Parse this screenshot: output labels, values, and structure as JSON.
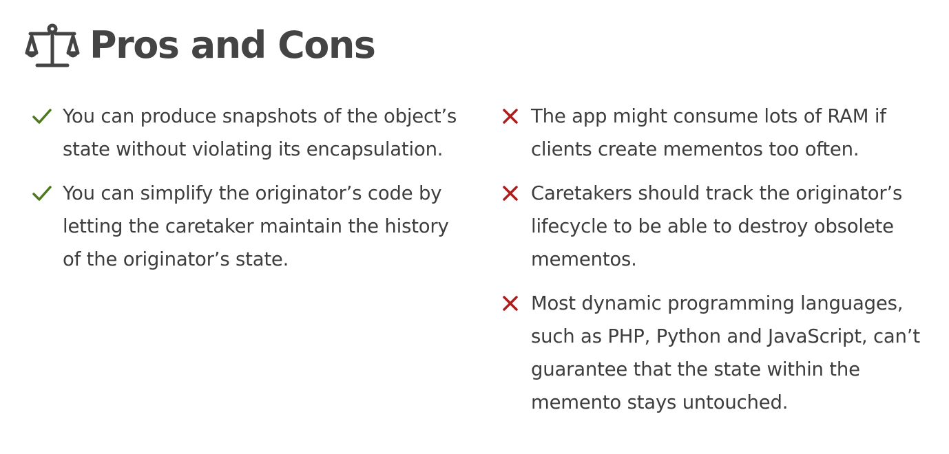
{
  "header": {
    "title": "Pros and Cons",
    "icon": "balance-scale-icon"
  },
  "pros": {
    "icon": "checkmark-icon",
    "color": "#4a7a1c",
    "items": [
      "You can produce snapshots of the object’s state without violating its encapsulation.",
      "You can simplify the originator’s code by letting the caretaker maintain the history of the originator’s state."
    ]
  },
  "cons": {
    "icon": "cross-icon",
    "color": "#b01c1c",
    "items": [
      "The app might consume lots of RAM if clients create mementos too often.",
      "Caretakers should track the originator’s lifecycle to be able to destroy obsolete mementos.",
      "Most dynamic programming languages, such as PHP, Python and JavaScript, can’t guarantee that the state within the memento stays untouched."
    ]
  }
}
